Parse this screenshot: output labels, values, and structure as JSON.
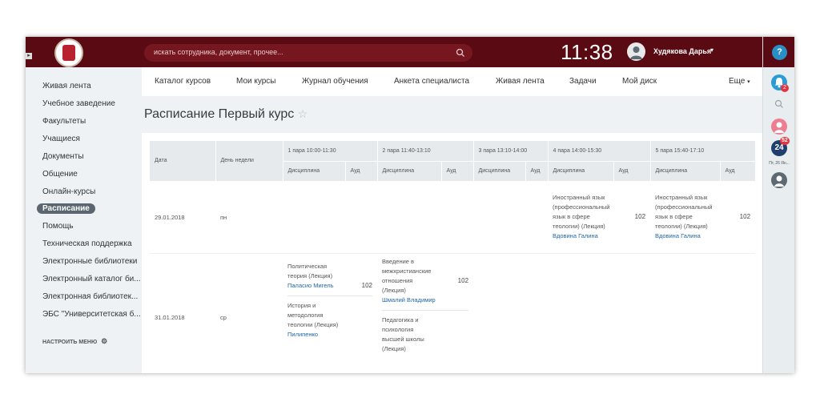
{
  "header": {
    "search_placeholder": "искать сотрудника, документ, прочее...",
    "clock": "11:38",
    "user_name": "Худякова Дарья"
  },
  "rail": {
    "bell_badge": "2",
    "b24_badge": "52",
    "b24_label": "24",
    "date": "Пт, 26 Ян...",
    "help": "?"
  },
  "sidebar": {
    "items": [
      {
        "label": "Живая лента"
      },
      {
        "label": "Учебное заведение"
      },
      {
        "label": "Факультеты"
      },
      {
        "label": "Учащиеся"
      },
      {
        "label": "Документы"
      },
      {
        "label": "Общение"
      },
      {
        "label": "Онлайн-курсы"
      },
      {
        "label": "Расписание"
      },
      {
        "label": "Помощь"
      },
      {
        "label": "Техническая поддержка"
      },
      {
        "label": "Электронные библиотеки"
      },
      {
        "label": "Электронный каталог би..."
      },
      {
        "label": "Электронная библиотек..."
      },
      {
        "label": "ЭБС \"Университетская б..."
      }
    ],
    "configure": "НАСТРОИТЬ МЕНЮ"
  },
  "tabs": [
    {
      "label": "Каталог курсов"
    },
    {
      "label": "Мои курсы"
    },
    {
      "label": "Журнал обучения"
    },
    {
      "label": "Анкета специалиста"
    },
    {
      "label": "Живая лента"
    },
    {
      "label": "Задачи"
    },
    {
      "label": "Мой диск"
    },
    {
      "label": "Еще"
    }
  ],
  "page": {
    "title": "Расписание Первый курс"
  },
  "table": {
    "date_header": "Дата",
    "weekday_header": "Дeнь недели",
    "discipline": "Дисциплина",
    "aud": "Ауд",
    "pairs": [
      "1 пара 10:00-11:30",
      "2 пара 11:40-13:10",
      "3 пара 13:10-14:00",
      "4 пара 14:00-15:30",
      "5 пара 15:40-17:10"
    ],
    "rows": [
      {
        "date": "29.01.2018",
        "weekday": "пн",
        "p4": {
          "subject": "Иностранный язык (профессиональный язык в сфере теологии) (Лекция)",
          "teacher": "Вдовина Галина",
          "aud": "102"
        },
        "p5": {
          "subject": "Иностранный язык (профессиональный язык в сфере теологии) (Лекция)",
          "teacher": "Вдовина Галина",
          "aud": "102"
        }
      },
      {
        "date": "31.01.2018",
        "weekday": "ср",
        "p1a": {
          "subject": "Политическая теория (Лекция)",
          "teacher": "Паласио Мигель",
          "aud": "102"
        },
        "p1b": {
          "subject": "История и методология теологии (Лекция)",
          "teacher": "Пилипенко"
        },
        "p2a": {
          "subject": "Введение в межхристианские отношения (Лекция)",
          "teacher": "Шмалий Владимир",
          "aud": "102"
        },
        "p2b": {
          "subject": "Педагогика и психология высшей школы (Лекция)"
        }
      }
    ]
  }
}
